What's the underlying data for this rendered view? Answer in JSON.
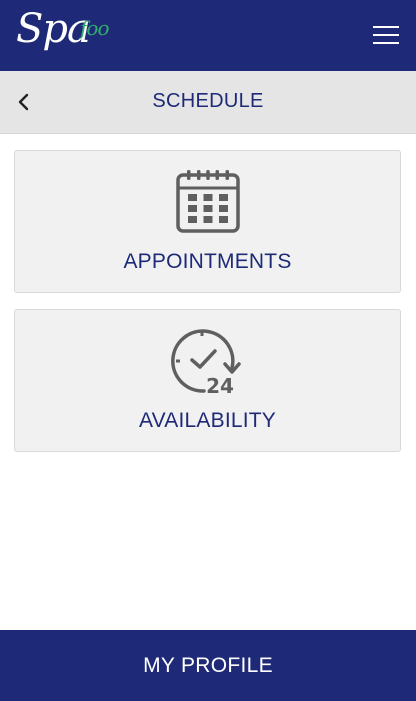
{
  "header": {
    "logo_main": "Spa",
    "logo_accent": "foo",
    "menu_icon": "hamburger-menu-icon"
  },
  "subheader": {
    "title": "SCHEDULE",
    "back_icon": "chevron-left-icon"
  },
  "cards": [
    {
      "label": "APPOINTMENTS",
      "icon": "calendar-icon"
    },
    {
      "label": "AVAILABILITY",
      "icon": "clock-24-icon",
      "icon_text": "24"
    }
  ],
  "footer": {
    "label": "MY PROFILE"
  },
  "colors": {
    "brand_navy": "#1e2a78",
    "logo_green": "#2fae6b",
    "icon_gray": "#5f5f5f",
    "card_bg": "#f1f1f1",
    "subbar_bg": "#e5e5e5"
  }
}
